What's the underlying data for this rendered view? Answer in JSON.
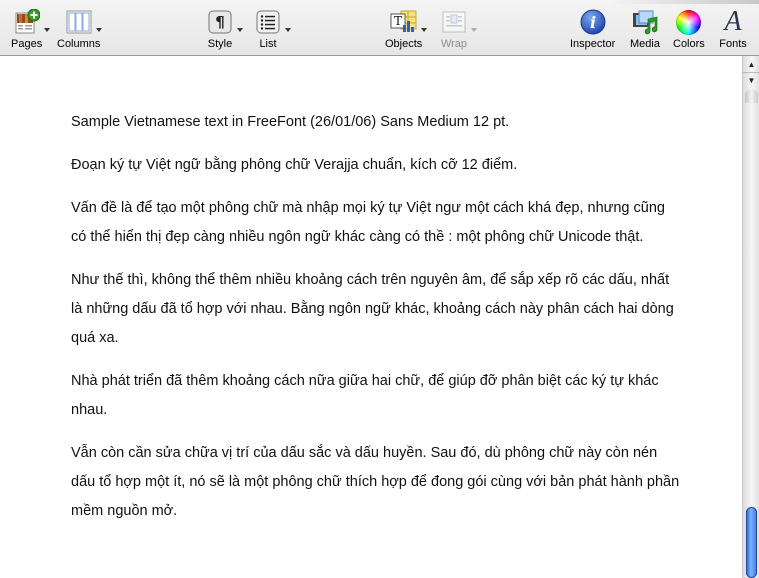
{
  "toolbar": {
    "left": [
      {
        "id": "pages",
        "label": "Pages",
        "icon": "pages-add-icon",
        "menu": true
      },
      {
        "id": "columns",
        "label": "Columns",
        "icon": "columns-icon",
        "menu": true
      },
      {
        "id": "style",
        "label": "Style",
        "icon": "pilcrow-icon",
        "menu": true
      },
      {
        "id": "list",
        "label": "List",
        "icon": "list-icon",
        "menu": true
      },
      {
        "id": "objects",
        "label": "Objects",
        "icon": "objects-icon",
        "menu": true
      },
      {
        "id": "wrap",
        "label": "Wrap",
        "icon": "wrap-icon",
        "menu": true,
        "disabled": true
      }
    ],
    "right": [
      {
        "id": "inspector",
        "label": "Inspector",
        "icon": "info-icon"
      },
      {
        "id": "media",
        "label": "Media",
        "icon": "media-icon"
      },
      {
        "id": "colors",
        "label": "Colors",
        "icon": "color-wheel-icon"
      },
      {
        "id": "fonts",
        "label": "Fonts",
        "icon": "font-a-icon",
        "glyph": "A"
      }
    ]
  },
  "document": {
    "paragraphs": [
      "Sample Vietnamese text in FreeFont (26/01/06) Sans Medium 12 pt.",
      "Đoạn ký tự Việt ngữ bằng phông chữ Verajja chuẩn, kích cỡ 12 điểm.",
      "Vấn đề là để tạo một phông chữ mà nhập mọi ký tự Việt ngư một cách khá đẹp, nhưng cũng có thể hiển thị đẹp càng nhiều ngôn ngữ khác càng có thề : một phông chữ Unicode thật.",
      "Như thế thì, không thể thêm nhiều khoảng cách trên nguyên âm, để sắp xếp rõ các dấu, nhất là những dấu đã tổ hợp với nhau. Bằng ngôn ngữ khác, khoảng cách này phân cách hai dòng quá xa.",
      "Nhà phát triển đã thêm khoảng cách nữa giữa hai chữ, để giúp đỡ phân biệt các ký tự khác nhau.",
      "Vẫn còn cần sửa chữa vị trí của dấu sắc và dấu huyền. Sau đó, dù phông chữ này còn nén dấu tổ hợp một ít, nó sẽ là một phông chữ thích hợp để đong gói cùng với bản phát hành phần mềm nguồn mở."
    ]
  },
  "scrollbar": {
    "scroll_position_fraction": 1.0,
    "visible_fraction": 0.15,
    "thumb_color": "#3d78e0"
  }
}
